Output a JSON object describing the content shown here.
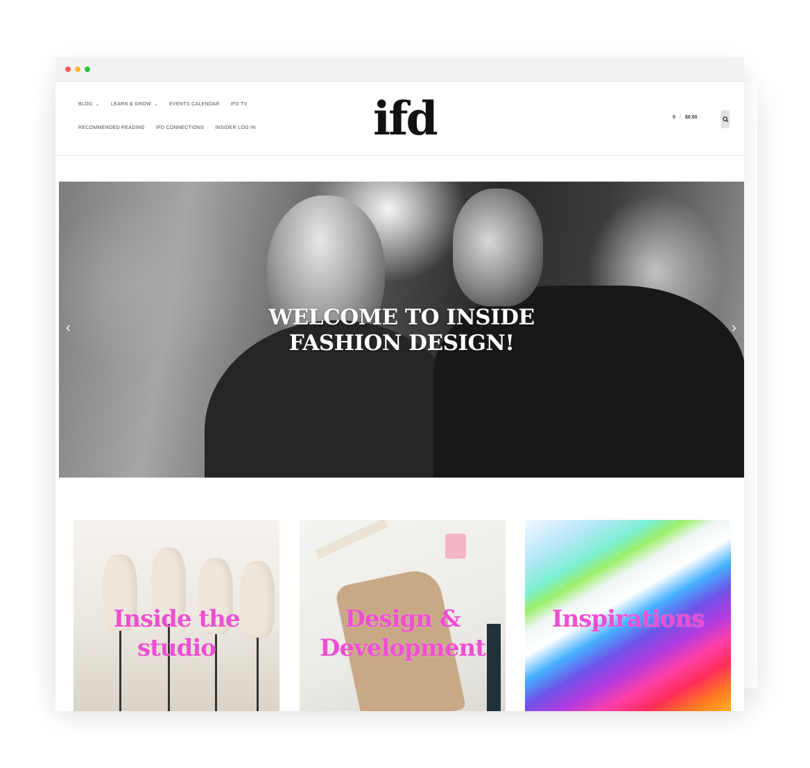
{
  "window": {
    "controls": [
      "close",
      "minimize",
      "maximize"
    ]
  },
  "nav": {
    "row1": [
      {
        "label": "BLOG",
        "has_dropdown": true
      },
      {
        "label": "LEARN & GROW",
        "has_dropdown": true
      },
      {
        "label": "EVENTS CALENDAR",
        "has_dropdown": false
      },
      {
        "label": "IFD TV",
        "has_dropdown": false
      }
    ],
    "row2": [
      {
        "label": "RECOMMENDED READING"
      },
      {
        "label": "IFD CONNECTIONS"
      },
      {
        "label": "INSIDER LOG IN"
      }
    ],
    "dropdown_glyph": "⌄"
  },
  "logo": {
    "text": "ifd"
  },
  "cart": {
    "count": "0",
    "separator": "/",
    "total": "$0.00"
  },
  "search": {
    "icon": "search-icon"
  },
  "hero": {
    "title_line1": "WELCOME TO INSIDE",
    "title_line2": "FASHION DESIGN!",
    "prev_glyph": "‹",
    "next_glyph": "›"
  },
  "tiles": [
    {
      "line1": "Inside the",
      "line2": "studio"
    },
    {
      "line1": "Design &",
      "line2": "Development"
    },
    {
      "line1": "Inspirations",
      "line2": ""
    }
  ],
  "colors": {
    "accent_pink": "#ee4fd2",
    "logo": "#111111",
    "nav_text": "#4a4a4a"
  }
}
